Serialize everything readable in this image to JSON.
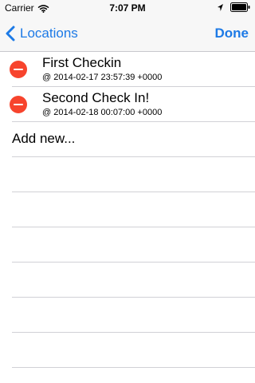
{
  "status_bar": {
    "carrier": "Carrier",
    "time": "7:07 PM"
  },
  "nav": {
    "back_label": "Locations",
    "done_label": "Done"
  },
  "rows": [
    {
      "title": "First Checkin",
      "subtitle": "@ 2014-02-17 23:57:39 +0000"
    },
    {
      "title": "Second Check In!",
      "subtitle": "@ 2014-02-18 00:07:00 +0000"
    }
  ],
  "add_row": {
    "label": "Add new..."
  },
  "colors": {
    "accent": "#1d7ae6",
    "delete": "#f7442d",
    "separator": "#d1d1d6",
    "bar_background": "#f7f7f7"
  },
  "icons": {
    "signal": "wifi-icon",
    "location": "location-arrow-icon",
    "battery": "battery-icon",
    "back": "chevron-left-icon",
    "delete": "minus-circle-icon"
  }
}
